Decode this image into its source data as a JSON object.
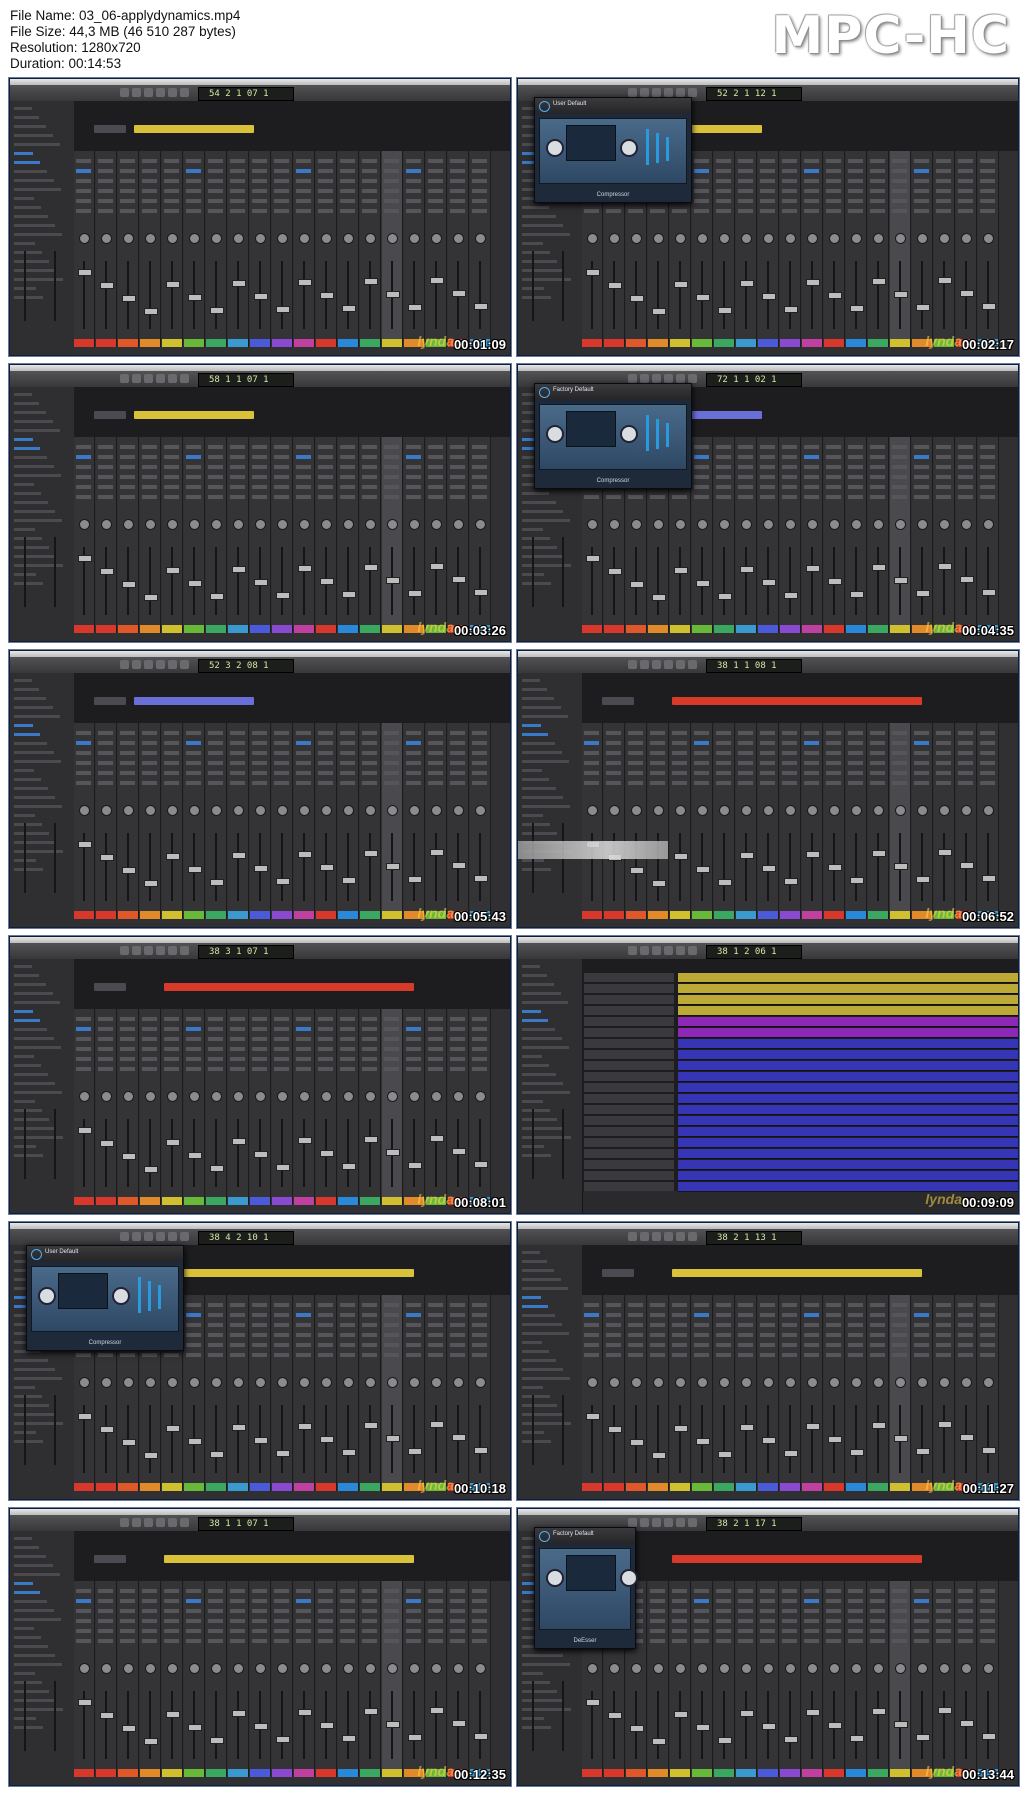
{
  "info": {
    "file_name": "File Name: 03_06-applydynamics.mp4",
    "file_size": "File Size: 44,3 MB (46 510 287 bytes)",
    "resolution": "Resolution: 1280x720",
    "duration": "Duration: 00:14:53"
  },
  "brand": "MPC-HC",
  "watermark": "lynda",
  "thumbnails": [
    {
      "timestamp": "00:01:09",
      "lcd": "54 2 1 07 1",
      "region_color": "#d9c23a",
      "plugin": null
    },
    {
      "timestamp": "00:02:17",
      "lcd": "52 2 1 12 1",
      "region_color": "#d9c23a",
      "plugin": {
        "preset": "User Default",
        "name": "Compressor"
      }
    },
    {
      "timestamp": "00:03:26",
      "lcd": "58 1 1 07 1",
      "region_color": "#d9c23a",
      "plugin": null
    },
    {
      "timestamp": "00:04:35",
      "lcd": "72 1 1 02 1",
      "region_color": "#6a6fd8",
      "plugin": {
        "preset": "Factory Default",
        "name": "Compressor"
      }
    },
    {
      "timestamp": "00:05:43",
      "lcd": "52 3 2 08 1",
      "region_color": "#6a6fd8",
      "plugin": null
    },
    {
      "timestamp": "00:06:52",
      "lcd": "38 1 1 08 1",
      "region_color": "#d83a2a",
      "plugin": null
    },
    {
      "timestamp": "00:08:01",
      "lcd": "38 3 1 07 1",
      "region_color": "#d83a2a",
      "plugin": null
    },
    {
      "timestamp": "00:09:09",
      "lcd": "38 1 2 06 1",
      "region_color": "#3a3ad0",
      "plugin": null
    },
    {
      "timestamp": "00:10:18",
      "lcd": "38 4 2 10 1",
      "region_color": "#d9c23a",
      "plugin": {
        "preset": "User Default",
        "name": "Compressor"
      }
    },
    {
      "timestamp": "00:11:27",
      "lcd": "38 2 1 13 1",
      "region_color": "#d9c23a",
      "plugin": null
    },
    {
      "timestamp": "00:12:35",
      "lcd": "38 1 1 07 1",
      "region_color": "#d9c23a",
      "plugin": null
    },
    {
      "timestamp": "00:13:44",
      "lcd": "38 2 1 17 1",
      "region_color": "#d83a2a",
      "plugin": {
        "preset": "Factory Default",
        "name": "DeEsser"
      }
    }
  ],
  "colors": {
    "nameplates": [
      "#d8382c",
      "#d8382c",
      "#e0572a",
      "#e08a2a",
      "#d0c030",
      "#68b83a",
      "#3aa860",
      "#3a9ad0",
      "#4a5ad8",
      "#8a4ad0",
      "#c040a0",
      "#d8382c",
      "#2a88d8",
      "#3aa860",
      "#d0c030",
      "#e08a2a",
      "#68b83a",
      "#d8382c",
      "#3a9ad0"
    ]
  }
}
